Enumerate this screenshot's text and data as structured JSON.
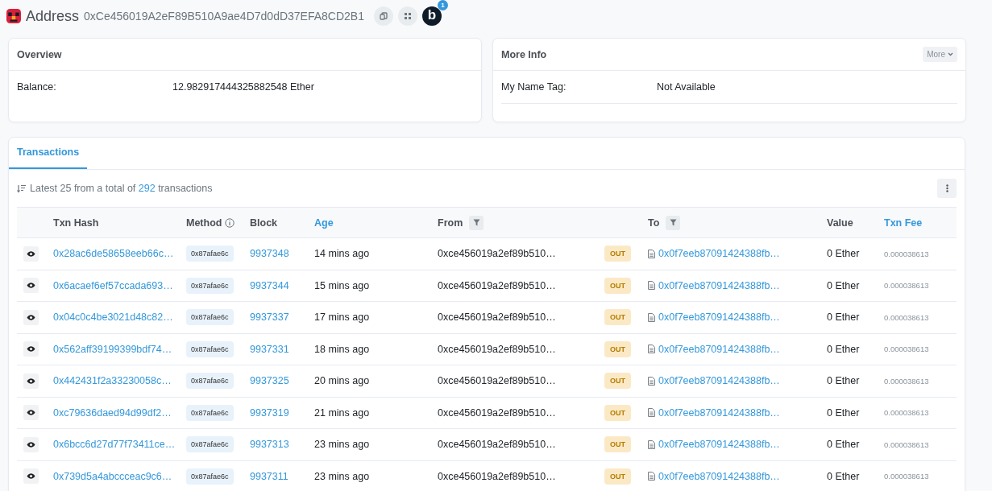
{
  "header": {
    "title": "Address",
    "address": "0xCe456019A2eF89B510A9ae4D7d0dD37EFA8CD2B1",
    "app_letter": "b",
    "app_badge": "1"
  },
  "overview": {
    "title": "Overview",
    "fields": [
      {
        "label": "Balance:",
        "value": "12.982917444325882548 Ether"
      }
    ]
  },
  "more_info": {
    "title": "More Info",
    "button": "More",
    "fields": [
      {
        "label": "My Name Tag:",
        "value": "Not Available"
      }
    ]
  },
  "tabs": [
    {
      "label": "Transactions",
      "selected": true
    }
  ],
  "summary": {
    "before": "Latest 25 from a total of",
    "count": "292",
    "after": "transactions"
  },
  "table": {
    "columns": [
      {
        "label": "Txn Hash",
        "kind": "plain"
      },
      {
        "label": "Method",
        "kind": "info"
      },
      {
        "label": "Block",
        "kind": "plain"
      },
      {
        "label": "Age",
        "kind": "sortable"
      },
      {
        "label": "From",
        "kind": "filter"
      },
      {
        "label": "To",
        "kind": "filter"
      },
      {
        "label": "Value",
        "kind": "plain"
      },
      {
        "label": "Txn Fee",
        "kind": "sortable"
      }
    ],
    "rows": [
      {
        "hash": "0x28ac6de58658eeb66c…",
        "method": "0x87afae6c",
        "block": "9937348",
        "age": "14 mins ago",
        "from": "0xce456019a2ef89b510…",
        "direction": "OUT",
        "to": "0x0f7eeb87091424388fb…",
        "value": "0 Ether",
        "fee": "0.000038613"
      },
      {
        "hash": "0x6acaef6ef57ccada693…",
        "method": "0x87afae6c",
        "block": "9937344",
        "age": "15 mins ago",
        "from": "0xce456019a2ef89b510…",
        "direction": "OUT",
        "to": "0x0f7eeb87091424388fb…",
        "value": "0 Ether",
        "fee": "0.000038613"
      },
      {
        "hash": "0x04c0c4be3021d48c82…",
        "method": "0x87afae6c",
        "block": "9937337",
        "age": "17 mins ago",
        "from": "0xce456019a2ef89b510…",
        "direction": "OUT",
        "to": "0x0f7eeb87091424388fb…",
        "value": "0 Ether",
        "fee": "0.000038613"
      },
      {
        "hash": "0x562aff39199399bdf74…",
        "method": "0x87afae6c",
        "block": "9937331",
        "age": "18 mins ago",
        "from": "0xce456019a2ef89b510…",
        "direction": "OUT",
        "to": "0x0f7eeb87091424388fb…",
        "value": "0 Ether",
        "fee": "0.000038613"
      },
      {
        "hash": "0x442431f2a33230058c…",
        "method": "0x87afae6c",
        "block": "9937325",
        "age": "20 mins ago",
        "from": "0xce456019a2ef89b510…",
        "direction": "OUT",
        "to": "0x0f7eeb87091424388fb…",
        "value": "0 Ether",
        "fee": "0.000038613"
      },
      {
        "hash": "0xc79636daed94d99df2…",
        "method": "0x87afae6c",
        "block": "9937319",
        "age": "21 mins ago",
        "from": "0xce456019a2ef89b510…",
        "direction": "OUT",
        "to": "0x0f7eeb87091424388fb…",
        "value": "0 Ether",
        "fee": "0.000038613"
      },
      {
        "hash": "0x6bcc6d27d77f73411ce…",
        "method": "0x87afae6c",
        "block": "9937313",
        "age": "23 mins ago",
        "from": "0xce456019a2ef89b510…",
        "direction": "OUT",
        "to": "0x0f7eeb87091424388fb…",
        "value": "0 Ether",
        "fee": "0.000038613"
      },
      {
        "hash": "0x739d5a4abccceac9c6…",
        "method": "0x87afae6c",
        "block": "9937311",
        "age": "23 mins ago",
        "from": "0xce456019a2ef89b510…",
        "direction": "OUT",
        "to": "0x0f7eeb87091424388fb…",
        "value": "0 Ether",
        "fee": "0.000038613"
      }
    ]
  }
}
